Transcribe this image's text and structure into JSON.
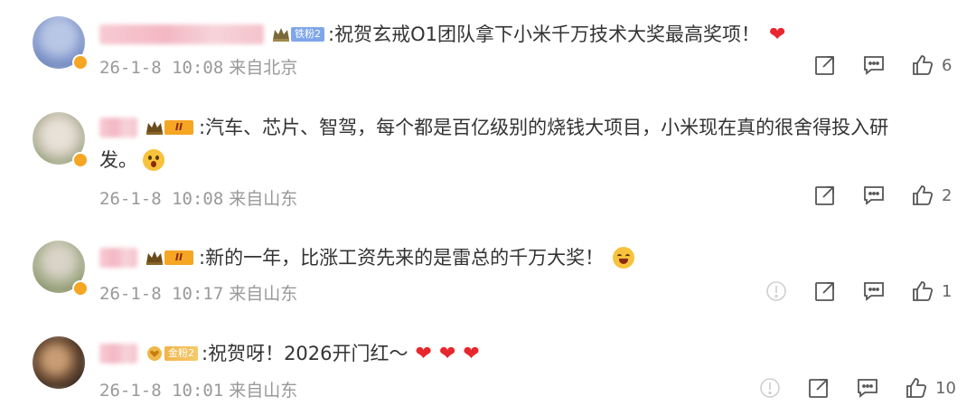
{
  "comments": [
    {
      "badge_text": "铁粉2",
      "badge_color": "#7fa6e8",
      "text": ":祝贺玄戒O1团队拿下小米千万技术大奖最高奖项！",
      "text_cont": "",
      "emoji": "heart",
      "date": "26-1-8 10:08",
      "location": "来自北京",
      "likes": "6",
      "has_report": false
    },
    {
      "badge_text": "II",
      "badge_color": "#f5a623",
      "text": ":汽车、芯片、智驾，每个都是百亿级别的烧钱大项目，小米现在真的很舍得投入研",
      "text_cont": "发。",
      "emoji": "surprised-face",
      "date": "26-1-8 10:08",
      "location": "来自山东",
      "likes": "2",
      "has_report": false
    },
    {
      "badge_text": "II",
      "badge_color": "#f5a623",
      "text": ":新的一年，比涨工资先来的是雷总的千万大奖！",
      "text_cont": "",
      "emoji": "tears-face",
      "date": "26-1-8 10:17",
      "location": "来自山东",
      "likes": "1",
      "has_report": true
    },
    {
      "badge_text": "金粉2",
      "badge_color": "#f0b84a",
      "text": ":祝贺呀！2026开门红～",
      "text_cont": "",
      "emoji": "three-hearts",
      "date": "26-1-8 10:01",
      "location": "来自山东",
      "likes": "10",
      "has_report": true
    }
  ]
}
